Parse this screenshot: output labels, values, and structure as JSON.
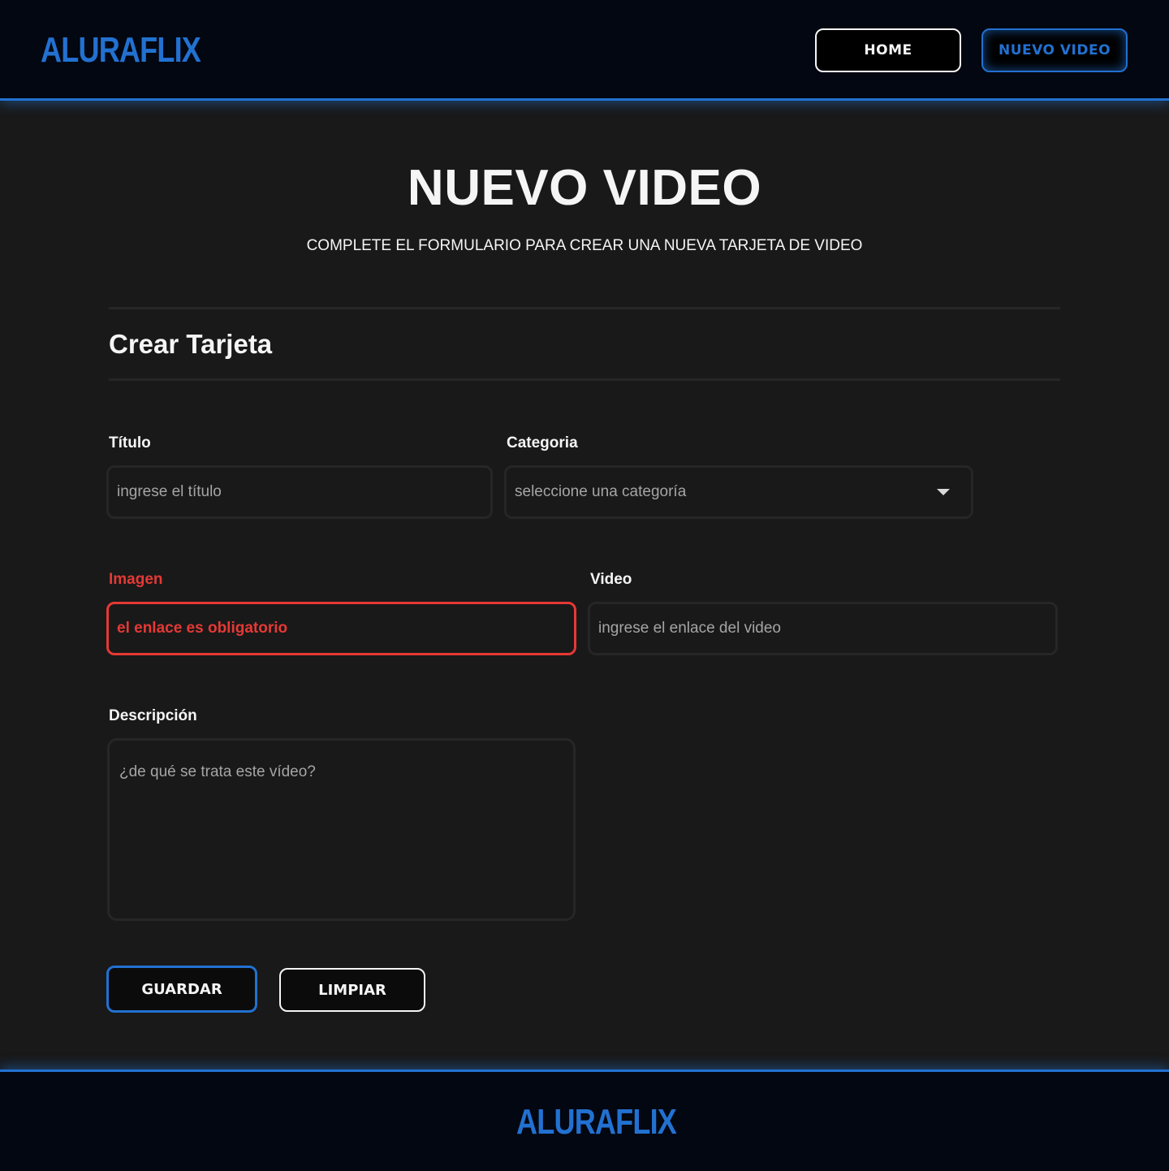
{
  "brand": {
    "logo_text": "ALURAFLIX",
    "accent_color": "#2271d1",
    "error_color": "#e53935"
  },
  "nav": {
    "home_label": "HOME",
    "nuevo_video_label": "NUEVO VIDEO"
  },
  "hero": {
    "title": "NUEVO VIDEO",
    "subtitle": "COMPLETE EL FORMULARIO PARA CREAR UNA NUEVA TARJETA DE VIDEO"
  },
  "section": {
    "title": "Crear Tarjeta"
  },
  "form": {
    "titulo": {
      "label": "Título",
      "placeholder": "ingrese el título",
      "value": ""
    },
    "categoria": {
      "label": "Categoria",
      "selected": "seleccione una categoría",
      "icon": "chevron-down-icon"
    },
    "imagen": {
      "label": "Imagen",
      "error_message": "el enlace es obligatorio",
      "value": ""
    },
    "video": {
      "label": "Video",
      "placeholder": "ingrese el enlace del video",
      "value": ""
    },
    "descripcion": {
      "label": "Descripción",
      "placeholder": "¿de qué se trata este vídeo?",
      "value": ""
    }
  },
  "actions": {
    "guardar_label": "GUARDAR",
    "limpiar_label": "LIMPIAR"
  },
  "footer": {
    "logo_text": "ALURAFLIX"
  }
}
